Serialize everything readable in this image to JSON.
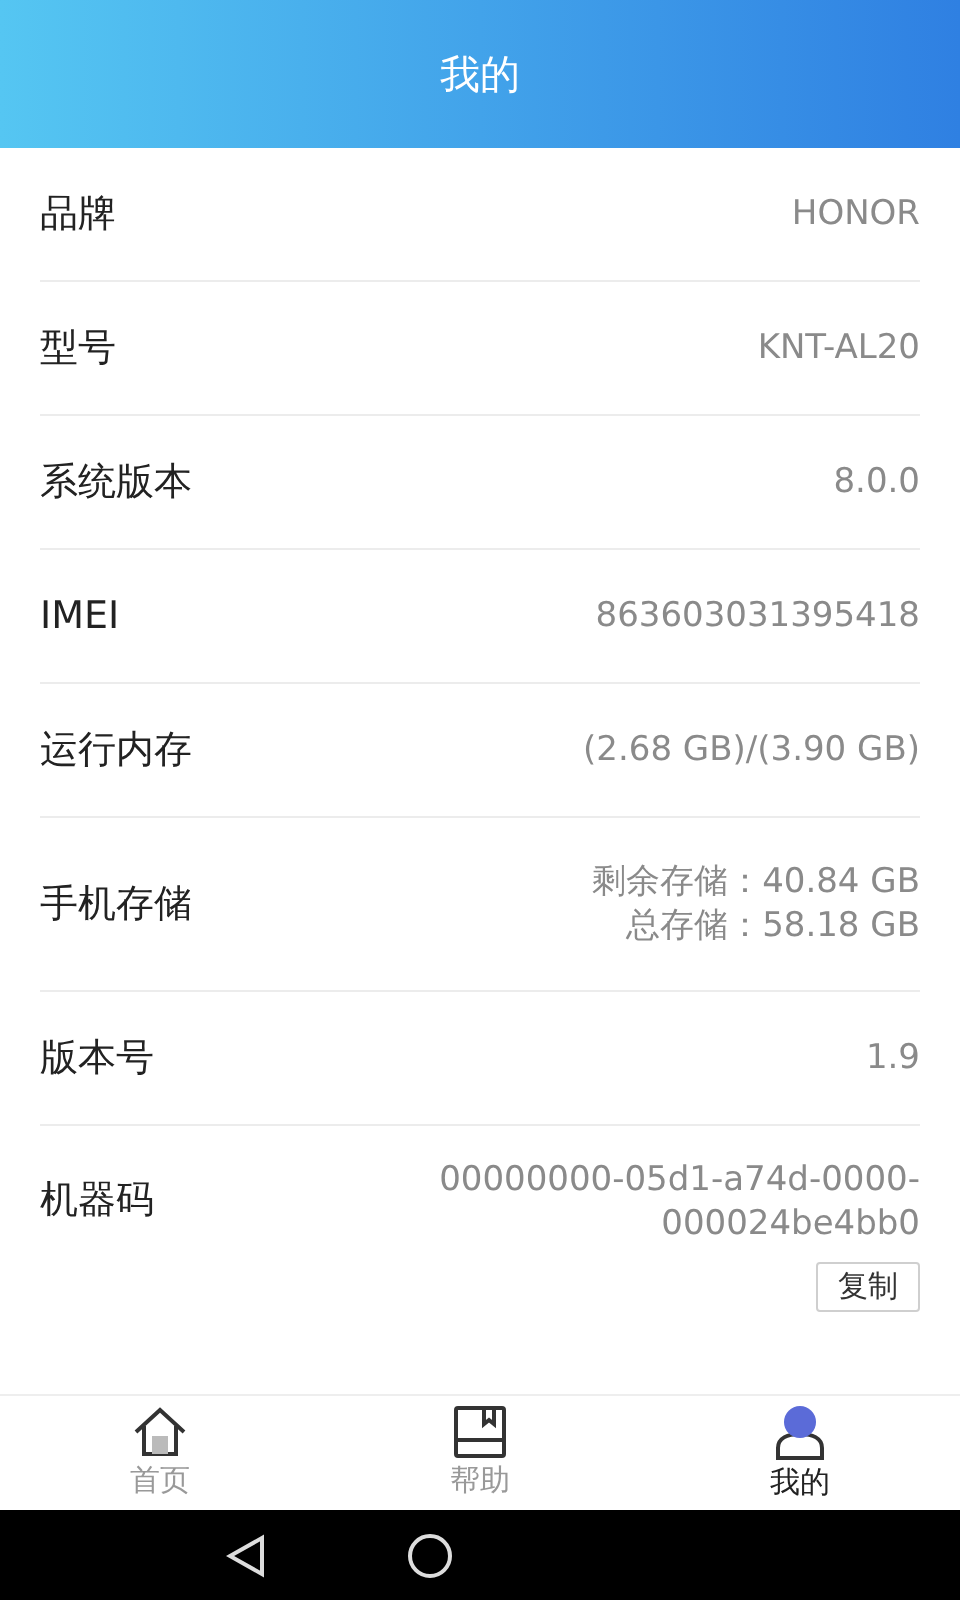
{
  "header": {
    "title": "我的"
  },
  "rows": [
    {
      "label": "品牌",
      "lines": [
        "HONOR"
      ]
    },
    {
      "label": "型号",
      "lines": [
        "KNT-AL20"
      ]
    },
    {
      "label": "系统版本",
      "lines": [
        "8.0.0"
      ]
    },
    {
      "label": "IMEI",
      "lines": [
        "863603031395418"
      ]
    },
    {
      "label": "运行内存",
      "lines": [
        "(2.68 GB)/(3.90 GB)"
      ]
    },
    {
      "label": "手机存储",
      "lines": [
        "剩余存储：40.84 GB",
        "总存储：58.18 GB"
      ]
    },
    {
      "label": "版本号",
      "lines": [
        "1.9"
      ]
    },
    {
      "label": "机器码",
      "lines": [
        "00000000-05d1-a74d-0000-",
        "000024be4bb0"
      ]
    }
  ],
  "copy_button": "复制",
  "tabs": [
    {
      "label": "首页",
      "kind": "home",
      "selected": false
    },
    {
      "label": "帮助",
      "kind": "book",
      "selected": false
    },
    {
      "label": "我的",
      "kind": "user",
      "selected": true
    }
  ]
}
